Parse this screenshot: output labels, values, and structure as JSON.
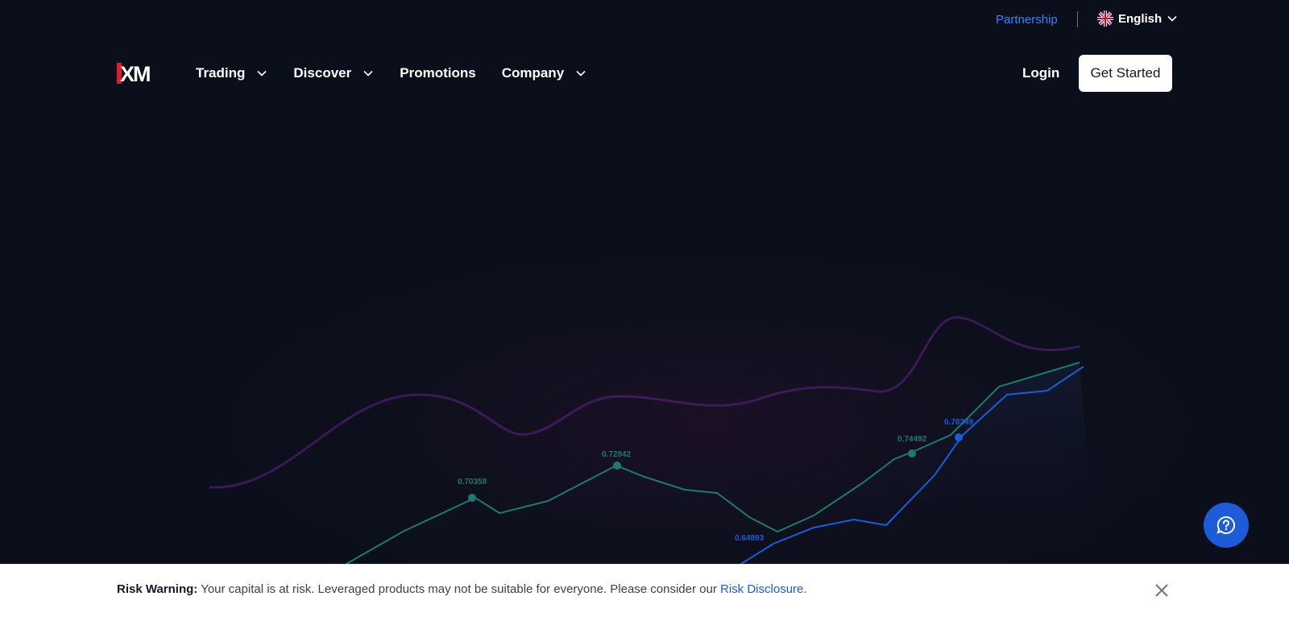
{
  "topbar": {
    "partnership": "Partnership",
    "language": "English",
    "flag_icon": "uk-flag-icon"
  },
  "navbar": {
    "logo_text": "XM",
    "items": [
      {
        "label": "Trading",
        "has_dropdown": true
      },
      {
        "label": "Discover",
        "has_dropdown": true
      },
      {
        "label": "Promotions",
        "has_dropdown": false
      },
      {
        "label": "Company",
        "has_dropdown": true
      }
    ],
    "login": "Login",
    "get_started": "Get Started"
  },
  "hero_chart": {
    "labels": [
      "0.70358",
      "0.72842",
      "0.74492",
      "0.78349",
      "0.64893"
    ]
  },
  "risk_warning": {
    "title": "Risk Warning:",
    "text": "Your capital is at risk. Leveraged products may not be suitable for everyone. Please consider our",
    "link": "Risk Disclosure",
    "suffix": "."
  },
  "colors": {
    "background": "#0b0f1b",
    "accent": "#1d5bd8",
    "partnership": "#3b82f6"
  }
}
